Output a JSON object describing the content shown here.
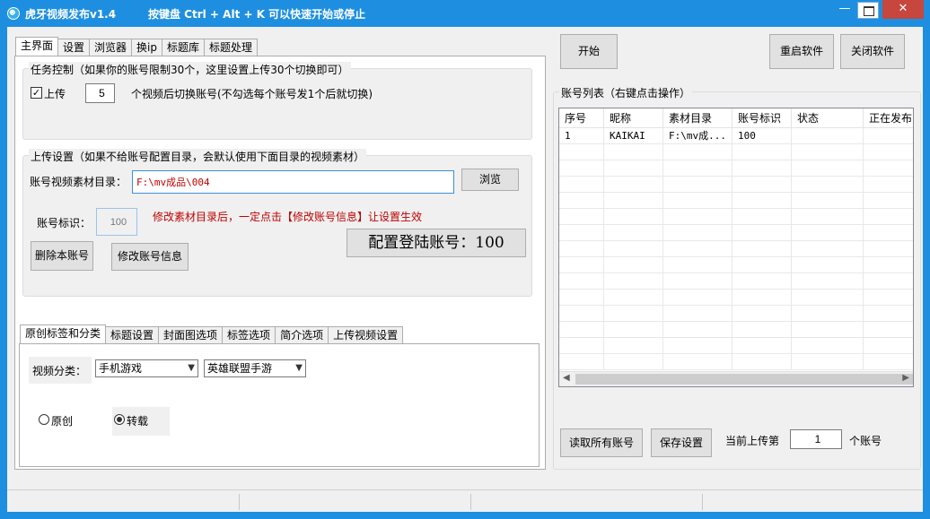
{
  "window": {
    "title": "虎牙视频发布v1.4",
    "hint": "按键盘 Ctrl + Alt + K  可以快速开始或停止",
    "min_glyph": "—",
    "close_glyph": "✕"
  },
  "main_tabs": [
    "主界面",
    "设置",
    "浏览器",
    "换ip",
    "标题库",
    "标题处理"
  ],
  "task_group": {
    "legend": "任务控制（如果你的账号限制30个，这里设置上传30个切换即可）",
    "upload_label": "上传",
    "upload_checked": true,
    "switch_count": "5",
    "switch_text": "个视频后切换账号(不勾选每个账号发1个后就切换)"
  },
  "upload_group": {
    "legend": "上传设置（如果不给账号配置目录，会默认使用下面目录的视频素材）",
    "dir_label": "账号视频素材目录：",
    "dir_value": "F:\\mv成品\\004",
    "browse_label": "浏览",
    "account_id_label": "账号标识：",
    "account_id_value": "100",
    "warning": "修改素材目录后，一定点击【修改账号信息】让设置生效",
    "delete_label": "删除本账号",
    "modify_label": "修改账号信息",
    "config_text": "配置登陆账号：100"
  },
  "sub_tabs": [
    "原创标签和分类",
    "标题设置",
    "封面图选项",
    "标签选项",
    "简介选项",
    "上传视频设置"
  ],
  "category": {
    "label": "视频分类：",
    "primary": "手机游戏",
    "secondary": "英雄联盟手游"
  },
  "type_radio": {
    "original": "原创",
    "reprint": "转载",
    "selected": "reprint"
  },
  "right": {
    "start_label": "开始",
    "restart_label": "重启软件",
    "close_label": "关闭软件",
    "list_legend": "账号列表（右键点击操作）",
    "columns": [
      "序号",
      "昵称",
      "素材目录",
      "账号标识",
      "状态",
      "正在发布"
    ],
    "rows": [
      [
        "1",
        "KAIKAI",
        "F:\\mv成...",
        "100",
        "",
        ""
      ]
    ],
    "read_all_label": "读取所有账号",
    "save_label": "保存设置",
    "current_prefix": "当前上传第",
    "current_value": "1",
    "current_suffix": "个账号"
  }
}
